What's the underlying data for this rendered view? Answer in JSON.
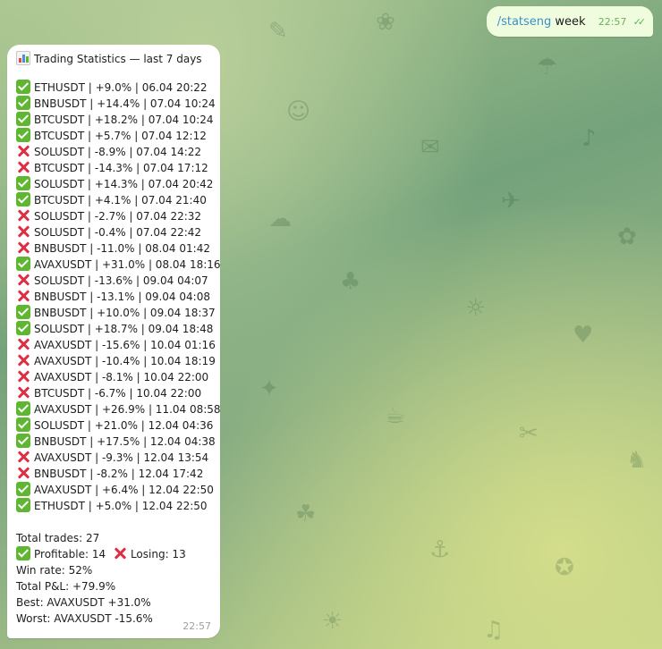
{
  "outgoing": {
    "command": "/statseng",
    "arg": "week",
    "time": "22:57",
    "status_icon": "double-check-icon"
  },
  "incoming": {
    "header_icon": "bar-chart-icon",
    "title": "Trading Statistics — last 7 days",
    "trades": [
      {
        "icon": "check",
        "text": "ETHUSDT | +9.0% | 06.04 20:22"
      },
      {
        "icon": "check",
        "text": "BNBUSDT | +14.4% | 07.04 10:24"
      },
      {
        "icon": "check",
        "text": "BTCUSDT | +18.2% | 07.04 10:24"
      },
      {
        "icon": "check",
        "text": "BTCUSDT | +5.7% | 07.04 12:12"
      },
      {
        "icon": "cross",
        "text": "SOLUSDT | -8.9% | 07.04 14:22"
      },
      {
        "icon": "cross",
        "text": "BTCUSDT | -14.3% | 07.04 17:12"
      },
      {
        "icon": "check",
        "text": "SOLUSDT | +14.3% | 07.04 20:42"
      },
      {
        "icon": "check",
        "text": "BTCUSDT | +4.1% | 07.04 21:40"
      },
      {
        "icon": "cross",
        "text": "SOLUSDT | -2.7% | 07.04 22:32"
      },
      {
        "icon": "cross",
        "text": "SOLUSDT | -0.4% | 07.04 22:42"
      },
      {
        "icon": "cross",
        "text": "BNBUSDT | -11.0% | 08.04 01:42"
      },
      {
        "icon": "check",
        "text": "AVAXUSDT | +31.0% | 08.04 18:16"
      },
      {
        "icon": "cross",
        "text": "SOLUSDT | -13.6% | 09.04 04:07"
      },
      {
        "icon": "cross",
        "text": "BNBUSDT | -13.1% | 09.04 04:08"
      },
      {
        "icon": "check",
        "text": "BNBUSDT | +10.0% | 09.04 18:37"
      },
      {
        "icon": "check",
        "text": "SOLUSDT | +18.7% | 09.04 18:48"
      },
      {
        "icon": "cross",
        "text": "AVAXUSDT | -15.6% | 10.04 01:16"
      },
      {
        "icon": "cross",
        "text": "AVAXUSDT | -10.4% | 10.04 18:19"
      },
      {
        "icon": "cross",
        "text": "AVAXUSDT | -8.1% | 10.04 22:00"
      },
      {
        "icon": "cross",
        "text": "BTCUSDT | -6.7% | 10.04 22:00"
      },
      {
        "icon": "check",
        "text": "AVAXUSDT | +26.9% | 11.04 08:58"
      },
      {
        "icon": "check",
        "text": "SOLUSDT | +21.0% | 12.04 04:36"
      },
      {
        "icon": "check",
        "text": "BNBUSDT | +17.5% | 12.04 04:38"
      },
      {
        "icon": "cross",
        "text": "AVAXUSDT | -9.3% | 12.04 13:54"
      },
      {
        "icon": "cross",
        "text": "BNBUSDT | -8.2% | 12.04 17:42"
      },
      {
        "icon": "check",
        "text": "AVAXUSDT | +6.4% | 12.04 22:50"
      },
      {
        "icon": "check",
        "text": "ETHUSDT | +5.0% | 12.04 22:50"
      }
    ],
    "summary": {
      "total": "Total trades: 27",
      "profitable": "Profitable: 14",
      "losing": "Losing: 13",
      "win_rate": "Win rate: 52%",
      "pnl": "Total P&L: +79.9%",
      "best": "Best: AVAXUSDT +31.0%",
      "worst": "Worst: AVAXUSDT -15.6%"
    },
    "time": "22:57"
  },
  "colors": {
    "check_green": "#5fb731",
    "cross_red": "#dd2e44",
    "outgoing_bubble": "#effdde",
    "link_blue": "#3b8fcf"
  }
}
